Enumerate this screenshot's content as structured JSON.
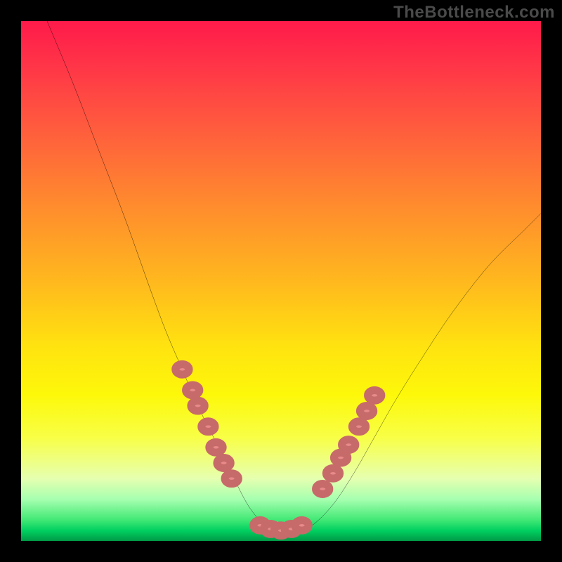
{
  "watermark": "TheBottleneck.com",
  "chart_data": {
    "type": "line",
    "title": "",
    "xlabel": "",
    "ylabel": "",
    "xlim": [
      0,
      100
    ],
    "ylim": [
      0,
      100
    ],
    "note": "Values are approximate — chart has no visible tick labels; y read as 0 (bottom/green) to 100 (top/red).",
    "curve": {
      "name": "bottleneck-curve",
      "x": [
        5,
        10,
        15,
        20,
        25,
        28,
        31,
        34,
        37,
        40,
        43,
        45,
        47,
        50,
        53,
        56,
        60,
        64,
        68,
        72,
        77,
        83,
        90,
        97,
        100
      ],
      "y": [
        100,
        88,
        75,
        62,
        48,
        40,
        33,
        26,
        20,
        14,
        8,
        5,
        3,
        2,
        2,
        3,
        7,
        13,
        20,
        27,
        35,
        44,
        53,
        60,
        63
      ]
    },
    "series": [
      {
        "name": "left-arm-dots",
        "x": [
          31,
          33,
          34,
          36,
          37.5,
          39,
          40.5
        ],
        "y": [
          33,
          29,
          26,
          22,
          18,
          15,
          12
        ]
      },
      {
        "name": "valley-dots",
        "x": [
          46,
          48,
          50,
          52,
          54
        ],
        "y": [
          3,
          2.3,
          2,
          2.3,
          3
        ]
      },
      {
        "name": "right-arm-dots",
        "x": [
          58,
          60,
          61.5,
          63,
          65,
          66.5,
          68
        ],
        "y": [
          10,
          13,
          16,
          18.5,
          22,
          25,
          28
        ]
      }
    ],
    "gradient_stops": [
      {
        "pos": 0,
        "color": "#ff1a4a"
      },
      {
        "pos": 50,
        "color": "#ffb81e"
      },
      {
        "pos": 72,
        "color": "#fdf80a"
      },
      {
        "pos": 96,
        "color": "#40e874"
      },
      {
        "pos": 100,
        "color": "#009a46"
      }
    ]
  }
}
